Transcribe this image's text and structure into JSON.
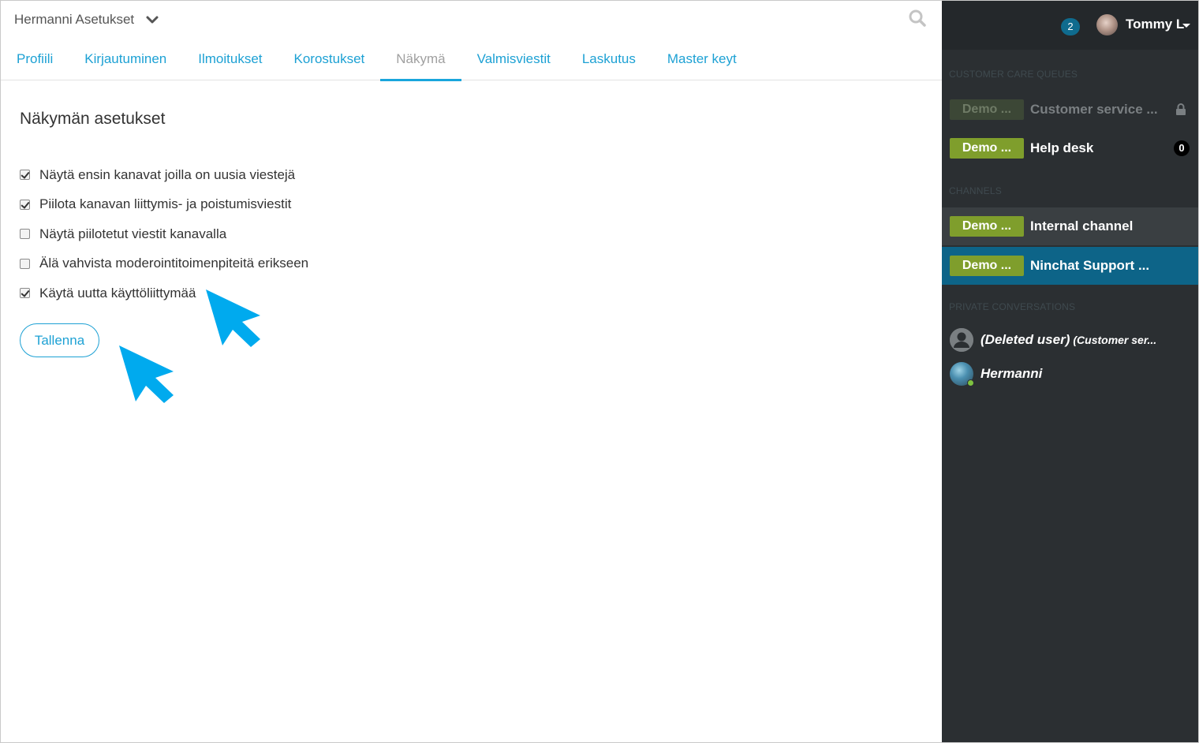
{
  "workspace": {
    "title": "Hermanni Asetukset"
  },
  "tabs": [
    {
      "label": "Profiili",
      "active": false
    },
    {
      "label": "Kirjautuminen",
      "active": false
    },
    {
      "label": "Ilmoitukset",
      "active": false
    },
    {
      "label": "Korostukset",
      "active": false
    },
    {
      "label": "Näkymä",
      "active": true
    },
    {
      "label": "Valmisviestit",
      "active": false
    },
    {
      "label": "Laskutus",
      "active": false
    },
    {
      "label": "Master keyt",
      "active": false
    }
  ],
  "settings": {
    "title": "Näkymän asetukset",
    "options": [
      {
        "label": "Näytä ensin kanavat joilla on uusia viestejä",
        "checked": true
      },
      {
        "label": "Piilota kanavan liittymis- ja poistumisviestit",
        "checked": true
      },
      {
        "label": "Näytä piilotetut viestit kanavalla",
        "checked": false
      },
      {
        "label": "Älä vahvista moderointitoimenpiteitä erikseen",
        "checked": false
      },
      {
        "label": "Käytä uutta käyttöliittymää",
        "checked": true
      }
    ],
    "save_label": "Tallenna"
  },
  "sidebar": {
    "notification_count": "2",
    "user_name": "Tommy L",
    "queues_label": "CUSTOMER CARE QUEUES",
    "queues": [
      {
        "tag": "Demo ...",
        "label": "Customer service ...",
        "locked": true
      },
      {
        "tag": "Demo ...",
        "label": "Help desk",
        "count": "0"
      }
    ],
    "channels_label": "CHANNELS",
    "channels": [
      {
        "tag": "Demo ...",
        "label": "Internal channel"
      },
      {
        "tag": "Demo ...",
        "label": "Ninchat Support ..."
      }
    ],
    "private_label": "PRIVATE CONVERSATIONS",
    "private": [
      {
        "name": "(Deleted user)",
        "sub": "(Customer ser..."
      },
      {
        "name": "Hermanni",
        "sub": ""
      }
    ]
  },
  "colors": {
    "accent": "#1da1d4",
    "sidebar_bg": "#2b2f32",
    "selected_row": "#0d6488",
    "tag_green": "#7f9e2c",
    "arrow": "#00aaee"
  }
}
